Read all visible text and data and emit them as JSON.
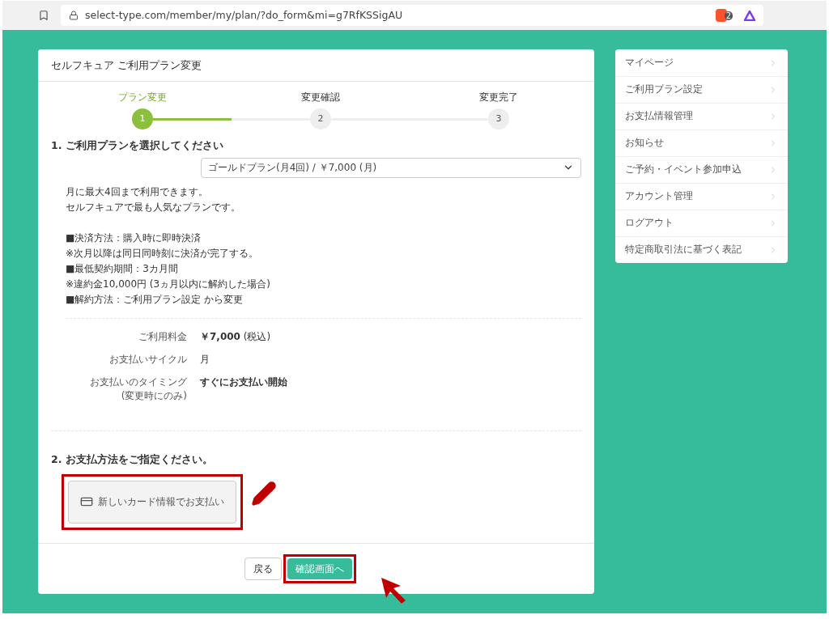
{
  "browser": {
    "url": "select-type.com/member/my/plan/?do_form&mi=g7RfKSSigAU",
    "badge": "2"
  },
  "card": {
    "title": "セルフキュア ご利用プラン変更",
    "steps": [
      {
        "label": "プラン変更",
        "number": "1",
        "selected": true
      },
      {
        "label": "変更確認",
        "number": "2",
        "selected": false
      },
      {
        "label": "変更完了",
        "number": "3",
        "selected": false
      }
    ],
    "progress": [
      {
        "level": 0.5
      },
      {
        "level": 0
      }
    ],
    "section1": {
      "heading": "1. ご利用プランを選択してください",
      "plan_select": {
        "value": "ゴールドプラン(月4回) / ￥7,000 (月)"
      },
      "description": [
        {
          "kind": "text",
          "text": "月に最大4回まで利用できます。"
        },
        {
          "kind": "text",
          "text": "セルフキュアで最も人気なプランです。"
        },
        {
          "kind": "gap"
        },
        {
          "kind": "text",
          "text": "■決済方法：購入時に即時決済"
        },
        {
          "kind": "note",
          "text": "※次月以降は同日同時刻に決済が完了する。"
        },
        {
          "kind": "text",
          "text": "■最低契約期間：3カ月間"
        },
        {
          "kind": "note",
          "text": "※違約金10,000円 (3ヵ月以内に解約した場合)"
        },
        {
          "kind": "text",
          "text": "■解約方法：ご利用プラン設定 から変更"
        }
      ],
      "details": [
        {
          "label": "ご利用料金",
          "value": "**￥7,000** (税込)"
        },
        {
          "label": "お支払いサイクル",
          "value": "月"
        },
        {
          "label": "お支払いのタイミング\n(変更時にのみ)",
          "value": "**すぐにお支払い開始**"
        }
      ]
    },
    "section2": {
      "heading": "2. お支払方法をご指定ください。",
      "card_button": "新しいカード情報でお支払い"
    },
    "footer": {
      "back": "戻る",
      "confirm": "確認画面へ"
    }
  },
  "sidebar": {
    "items": [
      "マイページ",
      "ご利用プラン設定",
      "お支払情報管理",
      "お知らせ",
      "ご予約・イベント参加申込",
      "アカウント管理",
      "ログアウト",
      "特定商取引法に基づく表記"
    ]
  }
}
